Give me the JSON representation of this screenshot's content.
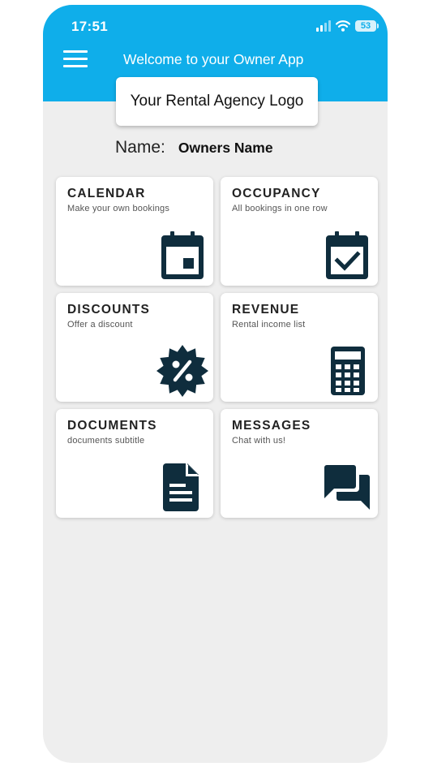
{
  "status_bar": {
    "time": "17:51",
    "battery": "53"
  },
  "header": {
    "title": "Welcome to your Owner App"
  },
  "logo": {
    "text": "Your Rental Agency Logo"
  },
  "owner": {
    "label": "Name:",
    "value": "Owners Name"
  },
  "colors": {
    "header_bg": "#0faeea",
    "icon_color": "#0f2d3d",
    "background": "#eeeeee"
  },
  "tiles": [
    {
      "title": "CALENDAR",
      "subtitle": "Make your own bookings",
      "icon": "calendar-icon"
    },
    {
      "title": "OCCUPANCY",
      "subtitle": "All bookings in one row",
      "icon": "calendar-check-icon"
    },
    {
      "title": "DISCOUNTS",
      "subtitle": "Offer a discount",
      "icon": "discount-badge-icon"
    },
    {
      "title": "REVENUE",
      "subtitle": "Rental income list",
      "icon": "calculator-icon"
    },
    {
      "title": "DOCUMENTS",
      "subtitle": "documents subtitle",
      "icon": "document-icon"
    },
    {
      "title": "MESSAGES",
      "subtitle": "Chat with us!",
      "icon": "chat-bubbles-icon"
    }
  ]
}
